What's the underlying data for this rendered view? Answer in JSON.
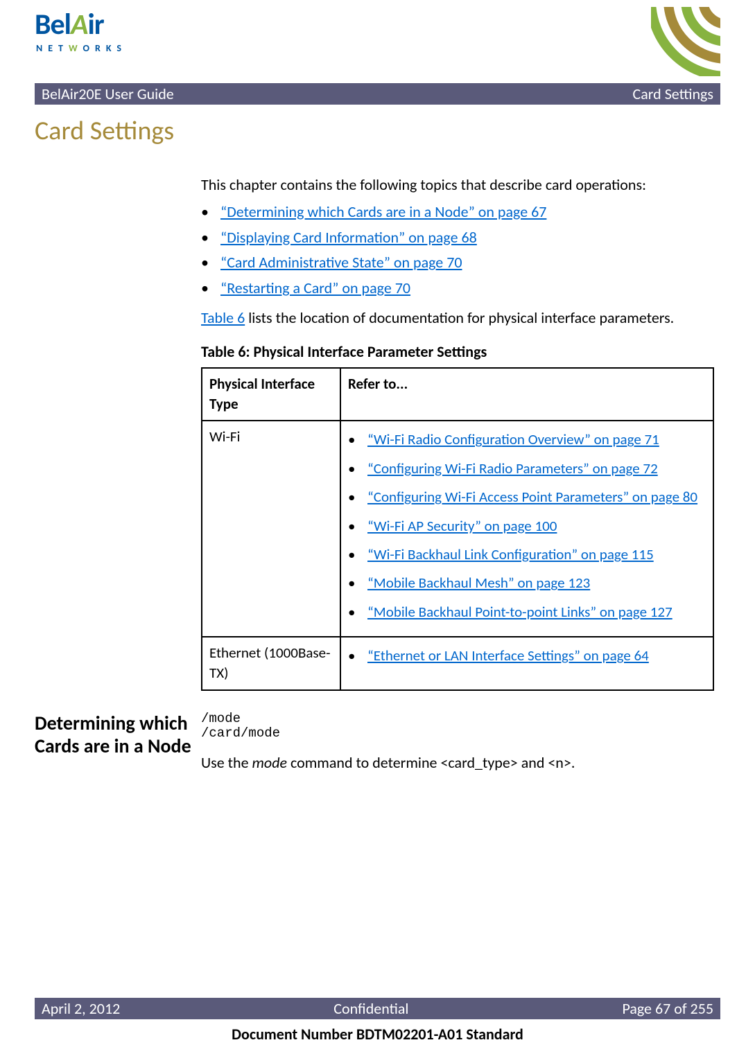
{
  "header": {
    "logo_brand_1": "Bel",
    "logo_brand_2": "A",
    "logo_brand_3": "ir",
    "logo_sub_1": "NET",
    "logo_sub_2": "W",
    "logo_sub_3": "ORKS"
  },
  "title_bar": {
    "left": "BelAir20E User Guide",
    "right": "Card Settings"
  },
  "chapter_title": "Card Settings",
  "intro": "This chapter contains the following topics that describe card operations:",
  "topic_links": [
    "“Determining which Cards are in a Node” on page 67",
    "“Displaying Card Information” on page 68",
    "“Card Administrative State” on page 70",
    "“Restarting a Card” on page 70"
  ],
  "table_ref_link": "Table 6",
  "table_ref_rest": " lists the location of documentation for physical interface parameters.",
  "table_caption": "Table 6: Physical Interface Parameter Settings",
  "table_headers": {
    "col1": "Physical Interface Type",
    "col2": "Refer to..."
  },
  "table_rows": [
    {
      "type": "Wi-Fi",
      "refs": [
        "“Wi-Fi Radio Configuration Overview” on page 71",
        "“Configuring Wi-Fi Radio Parameters” on page 72",
        "“Configuring Wi-Fi Access Point Parameters” on page 80",
        "“Wi-Fi AP Security” on page 100",
        "“Wi-Fi Backhaul Link Configuration” on page 115",
        "“Mobile Backhaul Mesh” on page 123",
        "“Mobile Backhaul Point-to-point Links” on page 127"
      ]
    },
    {
      "type": "Ethernet (1000Base-TX)",
      "refs": [
        "“Ethernet or LAN Interface Settings” on page 64"
      ]
    }
  ],
  "section": {
    "heading": "Determining which Cards are in a Node",
    "code": "/mode\n/card/mode",
    "use_prefix": "Use the ",
    "use_italic": "mode",
    "use_suffix": " command to determine <card_type> and <n>."
  },
  "footer": {
    "left": "April 2, 2012",
    "center": "Confidential",
    "right": "Page 67 of 255"
  },
  "doc_number": "Document Number BDTM02201-A01 Standard"
}
